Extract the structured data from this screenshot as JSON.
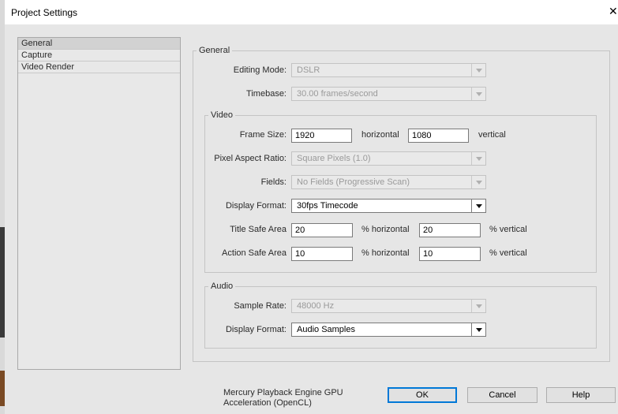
{
  "window": {
    "title": "Project Settings",
    "close_glyph": "✕"
  },
  "sidebar": {
    "items": [
      {
        "label": "General",
        "selected": true
      },
      {
        "label": "Capture",
        "selected": false
      },
      {
        "label": "Video Render",
        "selected": false
      }
    ]
  },
  "general": {
    "legend": "General",
    "editing_mode": {
      "label": "Editing Mode:",
      "value": "DSLR"
    },
    "timebase": {
      "label": "Timebase:",
      "value": "30.00 frames/second"
    }
  },
  "video": {
    "legend": "Video",
    "frame_size": {
      "label": "Frame Size:",
      "width": "1920",
      "width_unit": "horizontal",
      "height": "1080",
      "height_unit": "vertical"
    },
    "pixel_aspect_ratio": {
      "label": "Pixel Aspect Ratio:",
      "value": "Square Pixels (1.0)"
    },
    "fields": {
      "label": "Fields:",
      "value": "No Fields (Progressive Scan)"
    },
    "display_format": {
      "label": "Display Format:",
      "value": "30fps Timecode"
    },
    "title_safe": {
      "label": "Title Safe Area",
      "h": "20",
      "h_unit": "% horizontal",
      "v": "20",
      "v_unit": "% vertical"
    },
    "action_safe": {
      "label": "Action Safe Area",
      "h": "10",
      "h_unit": "% horizontal",
      "v": "10",
      "v_unit": "% vertical"
    }
  },
  "audio": {
    "legend": "Audio",
    "sample_rate": {
      "label": "Sample Rate:",
      "value": "48000 Hz"
    },
    "display_format": {
      "label": "Display Format:",
      "value": "Audio Samples"
    }
  },
  "footer": {
    "renderer_line1": "Mercury Playback Engine GPU",
    "renderer_line2": "Acceleration (OpenCL)",
    "ok_label": "OK",
    "cancel_label": "Cancel",
    "help_label": "Help"
  }
}
